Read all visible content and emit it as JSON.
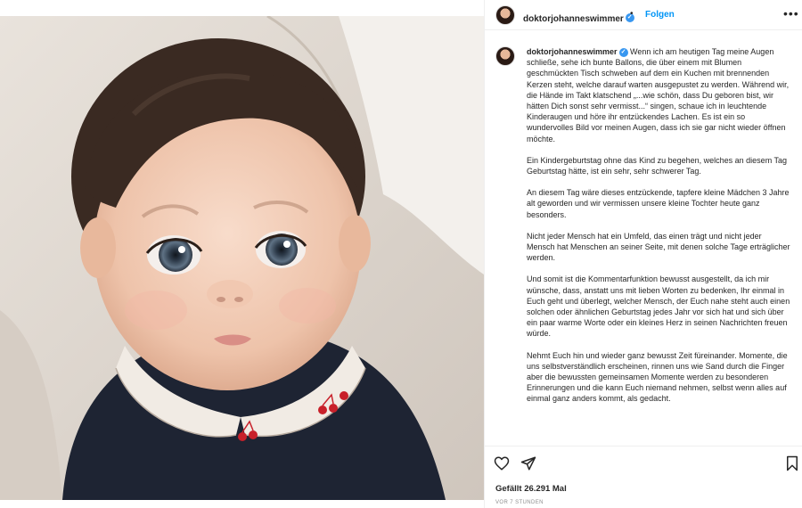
{
  "post": {
    "username": "doktorjohanneswimmer",
    "follow_label": "Folgen",
    "separator": "•",
    "more_label": "•••",
    "caption_paragraphs": [
      "Wenn ich am heutigen Tag meine Augen schließe, sehe ich bunte Ballons, die über einem mit Blumen geschmückten Tisch schweben auf dem ein Kuchen mit brennenden Kerzen steht, welche darauf warten ausgepustet zu werden. Während wir, die Hände im Takt klatschend „...wie schön, dass Du geboren bist, wir hätten Dich sonst sehr vermisst...“ singen, schaue ich in leuchtende Kinderaugen und höre ihr entzückendes Lachen. Es ist ein so wundervolles Bild vor meinen Augen, dass ich sie gar nicht wieder öffnen möchte.",
      "Ein Kindergeburtstag ohne das Kind zu begehen, welches an diesem Tag Geburtstag hätte, ist ein sehr, sehr schwerer Tag.",
      "An diesem Tag wäre dieses entzückende, tapfere kleine Mädchen 3 Jahre alt geworden und wir vermissen unsere kleine Tochter heute ganz besonders.",
      "Nicht jeder Mensch hat ein Umfeld, das einen trägt und nicht jeder Mensch hat Menschen an seiner Seite, mit denen solche Tage erträglicher werden.",
      "Und somit ist die Kommentarfunktion bewusst ausgestellt, da ich mir wünsche, dass, anstatt uns mit lieben Worten zu bedenken, Ihr einmal in Euch geht und überlegt, welcher Mensch, der Euch nahe steht auch einen solchen oder ähnlichen Geburtstag jedes Jahr vor sich hat und sich über ein paar warme Worte oder ein kleines Herz in seinen Nachrichten freuen würde.",
      "Nehmt Euch hin und wieder ganz bewusst Zeit füreinander. Momente, die uns selbstverständlich erscheinen, rinnen uns wie Sand durch die Finger aber die bewussten gemeinsamen Momente werden zu besonderen Erinnerungen und die kann Euch niemand nehmen, selbst wenn alles auf einmal ganz anders kommt, als gedacht."
    ],
    "likes_text": "Gefällt 26.291 Mal",
    "timestamp": "VOR 7 STUNDEN"
  },
  "icons": {
    "verified": "verified-badge-icon",
    "like": "heart-icon",
    "share": "paper-plane-icon",
    "save": "bookmark-icon"
  },
  "colors": {
    "accent": "#0095f6",
    "verified": "#3897f0",
    "text": "#262626",
    "muted": "#8e8e8e",
    "cherry": "#c8202a",
    "collar": "#f1ebe4",
    "sweater": "#1e2433"
  }
}
